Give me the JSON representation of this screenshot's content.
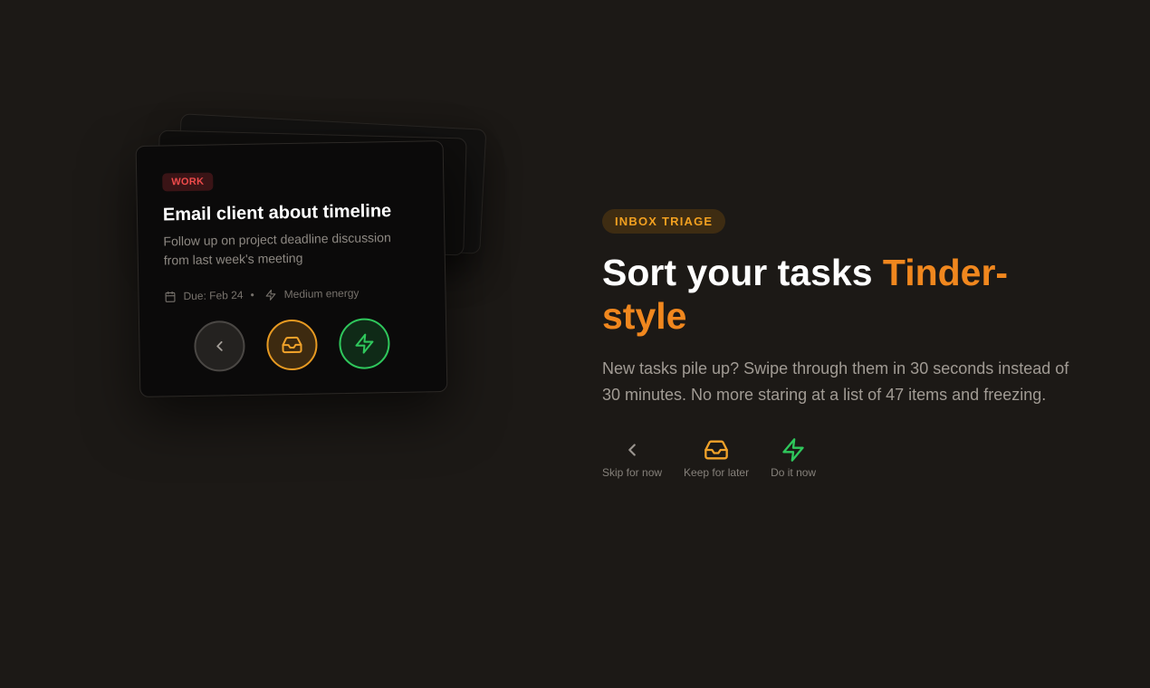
{
  "card": {
    "tag": "WORK",
    "title": "Email client about timeline",
    "description": "Follow up on project deadline discussion from last week's meeting",
    "due": "Due: Feb 24",
    "separator": "•",
    "energy": "Medium energy",
    "actions": [
      {
        "name": "skip",
        "icon": "chevron-left-icon"
      },
      {
        "name": "keep",
        "icon": "inbox-icon"
      },
      {
        "name": "now",
        "icon": "lightning-icon"
      }
    ]
  },
  "hero": {
    "badge": "INBOX TRIAGE",
    "headline_main": "Sort your tasks ",
    "headline_accent": "Tinder-style",
    "body": "New tasks pile up? Swipe through them in 30 seconds instead of 30 minutes. No more staring at a list of 47 items and freezing."
  },
  "legend": [
    {
      "icon": "chevron-left-icon",
      "label": "Skip for now"
    },
    {
      "icon": "inbox-icon",
      "label": "Keep for later"
    },
    {
      "icon": "lightning-icon",
      "label": "Do it now"
    }
  ],
  "colors": {
    "background": "#1c1916",
    "accent_orange": "#f0871e",
    "keep_amber": "#e79a22",
    "do_now_green": "#2fc75c",
    "tag_red": "#ef4b4b"
  }
}
